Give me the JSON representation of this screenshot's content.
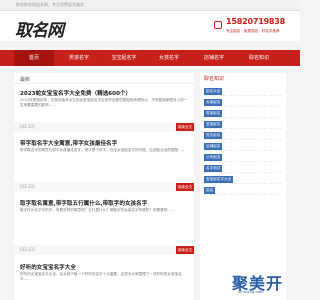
{
  "topbar": {
    "text": "取名取名网起名网，专注免费起名服务"
  },
  "header": {
    "logo": "取名网",
    "phone": "15820719838",
    "phone_sub": "专注起名 · 免费测名 · 好名字推荐"
  },
  "nav": {
    "items": [
      {
        "label": "首页",
        "active": true
      },
      {
        "label": "男孩名字",
        "active": false
      },
      {
        "label": "宝宝起名字",
        "active": false
      },
      {
        "label": "女孩名字",
        "active": false
      },
      {
        "label": "店铺名字",
        "active": false
      },
      {
        "label": "取名知识",
        "active": false
      }
    ]
  },
  "main": {
    "crumb": "最新",
    "articles": [
      {
        "title": "2023蛇女宝宝名字大全免费（精选600个）",
        "desc": "2023年是癸卯年，在癸卯兔年出生的女宝宝起名字应该符合哪些属相的命理特点，不同属相命理对人的一生有着重要的影响……",
        "date": "[02-23]",
        "btn": "阅读全文"
      },
      {
        "title": "带字取名字大全寓意,带字女孩最佳名字",
        "desc": "带字取名字的寓意与带字女孩最佳名字，带字是个好字，在给女孩起名字的时候，应选取合适的搭配……",
        "date": "[02-23]",
        "btn": "阅读全文"
      },
      {
        "title": "取字取名寓意,带字取五行属什么,带取字的女孩名字",
        "desc": "取字作为名字中的字，有着怎样的寓意呢？五行属什么？带取字的女孩名字有哪些？来看看吧……",
        "date": "[02-23]",
        "btn": "阅读全文"
      },
      {
        "title": "好听的女宝宝名字大全",
        "desc": "好听的女宝宝名字大全，给女孩子取一个好听的名字十分重要，这里为大家整理了一些好听的女宝宝名字……",
        "date": "[02-23]",
        "btn": "阅读全文"
      }
    ]
  },
  "side": {
    "title": "取名知识",
    "items": [
      "起名大全",
      "女孩起名",
      "男孩起名",
      "宝宝起名",
      "姓氏起名",
      "店铺起名",
      "公司起名",
      "名字测试",
      "宝宝起名字大全",
      "起名"
    ]
  },
  "watermark": {
    "text": "聚美开",
    "sub": "xinnlang.com"
  },
  "colors": {
    "brand": "#c8201a",
    "tag": "#3b6fb6"
  }
}
